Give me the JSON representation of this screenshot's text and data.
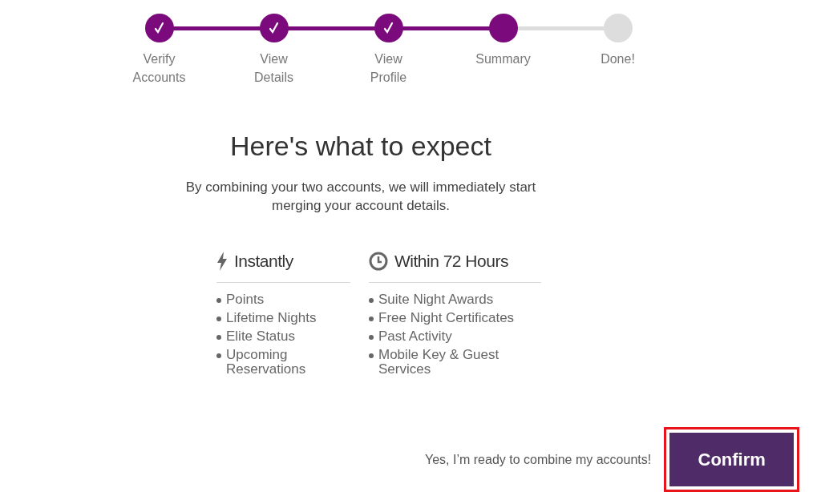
{
  "steps": [
    {
      "label": "Verify Accounts",
      "completed": true
    },
    {
      "label": "View Details",
      "completed": true
    },
    {
      "label": "View Profile",
      "completed": true
    },
    {
      "label": "Summary",
      "completed": false
    },
    {
      "label": "Done!",
      "completed": false
    }
  ],
  "heading": "Here's what to expect",
  "intro": "By combining your two accounts, we will immediately start merging your account details.",
  "columns": [
    {
      "kind": "instant",
      "title": "Instantly",
      "items": [
        "Points",
        "Lifetime Nights",
        "Elite Status",
        "Upcoming Reservations"
      ]
    },
    {
      "kind": "later",
      "title": "Within 72 Hours",
      "items": [
        "Suite Night Awards",
        "Free Night Certificates",
        "Past Activity",
        "Mobile Key & Guest Services"
      ]
    }
  ],
  "confirm_text": "Yes, I’m ready to combine my accounts!",
  "confirm_button": {
    "label": "Confirm",
    "highlighted": true
  }
}
